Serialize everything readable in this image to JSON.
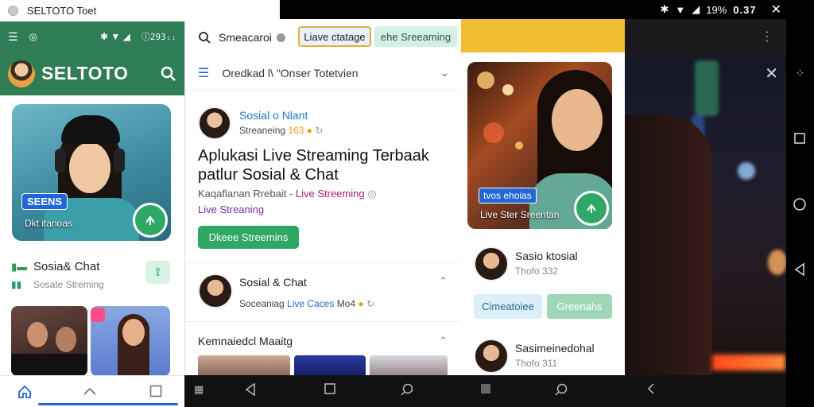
{
  "window": {
    "title": "SELTOTO Toet"
  },
  "panel1": {
    "status_right": "ⓘ293ᵢᵢ",
    "brand": "SELTOTO",
    "hero_badge": "SEENS",
    "hero_caption": "Dkt itanoas",
    "social_title": "Sosia& Chat",
    "social_sub": "Sosate Streming",
    "nav": [
      "home-icon",
      "chevron-up-icon",
      "square-icon"
    ]
  },
  "panel2": {
    "topbar_text": "Smeacaroi",
    "chip1": "Liave ctatage",
    "chip2": "ehe Sreeaming",
    "bar2_title": "Oredkad l\\ \"Onser Totetvien",
    "post": {
      "name": "Sosial o Nlant",
      "sub_prefix": "Streaneing",
      "sub_count": "163",
      "headline": "Aplukasi Live Streaming Terbaak patlur Sosial & Chat",
      "meta_prefix": "Kaqaflanan Rrebait -",
      "meta_highlight": "Live Streeming",
      "meta2": "Live Streaning",
      "button": "Dkeee Streemins"
    },
    "row1": {
      "name": "Sosial & Chat",
      "sub_prefix": "Soceaniag",
      "sub_highlight": "Live Caces",
      "sub_suffix": "Mo4"
    },
    "row2_title": "Kemnaiedcl Maaitg"
  },
  "panel3": {
    "hero_badge": "tvos ehoias",
    "hero_caption": "Live Ster Sreentan",
    "user1": {
      "name": "Sasio ktosial",
      "sub": "Thofo 332"
    },
    "chip1": "Cimeatoiee",
    "chip2": "Greenahs",
    "user2": {
      "name": "Sasimeinedohal",
      "sub": "Thofo 311"
    }
  },
  "status_bar": {
    "battery": "19%",
    "time": "0.37"
  },
  "colors": {
    "brand_green": "#2e7d55",
    "accent_green": "#2fa866",
    "accent_blue": "#2166d6",
    "yellow": "#f1bd30"
  }
}
